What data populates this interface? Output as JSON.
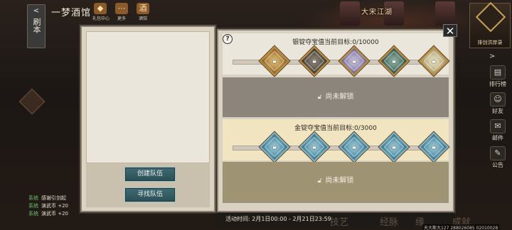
{
  "header": {
    "back_label": "刷本",
    "title": "一梦酒馆",
    "icons": [
      {
        "icon": "handbook-icon",
        "label": "礼包中心"
      },
      {
        "icon": "more-icon",
        "label": "更多"
      },
      {
        "icon": "tavern-icon",
        "label": "酒馆"
      }
    ],
    "scene_title": "大宋江湖",
    "corner_badge_label": "排剑洪岸录"
  },
  "right_rail": [
    {
      "icon": "leaderboard-icon",
      "label": "排行榜"
    },
    {
      "icon": "friends-icon",
      "label": "好友"
    },
    {
      "icon": "mail-icon",
      "label": "邮件"
    },
    {
      "icon": "announcement-icon",
      "label": "公告"
    }
  ],
  "chat_log": [
    {
      "tag": "系统",
      "msg": "感谢引剑起"
    },
    {
      "tag": "系统",
      "msg": "演武币 +20"
    },
    {
      "tag": "系统",
      "msg": "演武币 +20"
    }
  ],
  "team_panel": {
    "create_team_label": "创建队伍",
    "find_team_label": "寻找队伍"
  },
  "treasure_panel": {
    "help_label": "?",
    "close_label": "✕",
    "silver": {
      "title": "银锭夺宝值当前目标:0/10000",
      "progress": 0,
      "milestones": [
        {
          "color": "gold",
          "locked": true
        },
        {
          "color": "dark",
          "locked": true
        },
        {
          "color": "lilac",
          "locked": true
        },
        {
          "color": "teal",
          "locked": true
        },
        {
          "color": "cream",
          "locked": true
        }
      ],
      "locked_text": "尚未解锁"
    },
    "gold": {
      "title": "金锭夺宝值当前目标:0/3000",
      "progress": 0,
      "milestones": [
        {
          "color": "blue",
          "locked": true
        },
        {
          "color": "blue",
          "locked": true
        },
        {
          "color": "blue",
          "locked": true
        },
        {
          "color": "blue",
          "locked": true
        },
        {
          "color": "blue",
          "locked": true
        }
      ],
      "locked_text": "尚未解锁"
    },
    "activity_time": "活动时间: 2月1日00:00 - 2月21日23:59"
  },
  "status_bar": "天大斯大127 288026085 02010028",
  "colors": {
    "teal_button": "#2a4f56",
    "silver_section": "#ebe6dc",
    "gold_section": "#f1e5c1",
    "locked_silver": "#8c857b",
    "locked_gold": "#9e9474"
  }
}
